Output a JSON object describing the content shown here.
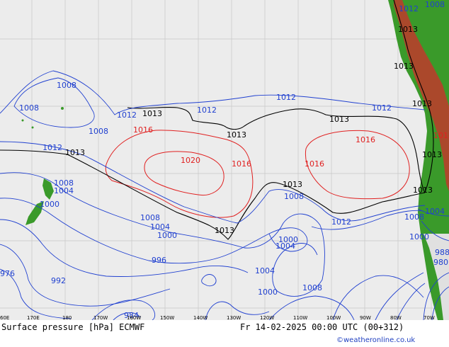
{
  "map": {
    "title": "Surface pressure [hPa] ECMWF",
    "valid_time": "Fr 14-02-2025 00:00 UTC (00+312)",
    "credit": "©weatheronline.co.uk",
    "longitude_labels": [
      "60E",
      "170E",
      "180",
      "170W",
      "160W",
      "150W",
      "140W",
      "130W",
      "120W",
      "110W",
      "100W",
      "90W",
      "80W",
      "70W"
    ],
    "colors": {
      "sea": "#ececec",
      "land": "#3a9a2a",
      "high_terrain": "#c0392b",
      "isobar_low": "#2040d0",
      "isobar_high": "#e02020",
      "isobar_1013": "#000000",
      "graticule": "#c8c8c8"
    },
    "isobar_labels": [
      {
        "text": "1008",
        "color": "blue"
      },
      {
        "text": "1008",
        "color": "blue"
      },
      {
        "text": "1012",
        "color": "blue"
      },
      {
        "text": "1013",
        "color": "black"
      },
      {
        "text": "1012",
        "color": "blue"
      },
      {
        "text": "1012",
        "color": "blue"
      },
      {
        "text": "1012",
        "color": "blue"
      },
      {
        "text": "1008",
        "color": "blue"
      },
      {
        "text": "1016",
        "color": "red"
      },
      {
        "text": "1013",
        "color": "black"
      },
      {
        "text": "1013",
        "color": "black"
      },
      {
        "text": "1016",
        "color": "red"
      },
      {
        "text": "1012",
        "color": "blue"
      },
      {
        "text": "1013",
        "color": "black"
      },
      {
        "text": "1020",
        "color": "red"
      },
      {
        "text": "1016",
        "color": "red"
      },
      {
        "text": "1016",
        "color": "red"
      },
      {
        "text": "1008",
        "color": "blue"
      },
      {
        "text": "1004",
        "color": "blue"
      },
      {
        "text": "1013",
        "color": "black"
      },
      {
        "text": "1008",
        "color": "blue"
      },
      {
        "text": "1000",
        "color": "blue"
      },
      {
        "text": "1008",
        "color": "blue"
      },
      {
        "text": "1004",
        "color": "blue"
      },
      {
        "text": "1000",
        "color": "blue"
      },
      {
        "text": "1013",
        "color": "black"
      },
      {
        "text": "1012",
        "color": "blue"
      },
      {
        "text": "1000",
        "color": "blue"
      },
      {
        "text": "1004",
        "color": "blue"
      },
      {
        "text": "996",
        "color": "blue"
      },
      {
        "text": "992",
        "color": "blue"
      },
      {
        "text": "976",
        "color": "blue"
      },
      {
        "text": "1004",
        "color": "blue"
      },
      {
        "text": "1000",
        "color": "blue"
      },
      {
        "text": "1008",
        "color": "blue"
      },
      {
        "text": "984",
        "color": "blue"
      },
      {
        "text": "1013",
        "color": "black"
      },
      {
        "text": "1013",
        "color": "black"
      },
      {
        "text": "1013",
        "color": "black"
      },
      {
        "text": "1016",
        "color": "red"
      },
      {
        "text": "1013",
        "color": "black"
      },
      {
        "text": "1013",
        "color": "black"
      },
      {
        "text": "1008",
        "color": "blue"
      },
      {
        "text": "1004",
        "color": "blue"
      },
      {
        "text": "1000",
        "color": "blue"
      },
      {
        "text": "988",
        "color": "blue"
      },
      {
        "text": "980",
        "color": "blue"
      },
      {
        "text": "1012",
        "color": "blue"
      },
      {
        "text": "1008",
        "color": "blue"
      }
    ]
  }
}
